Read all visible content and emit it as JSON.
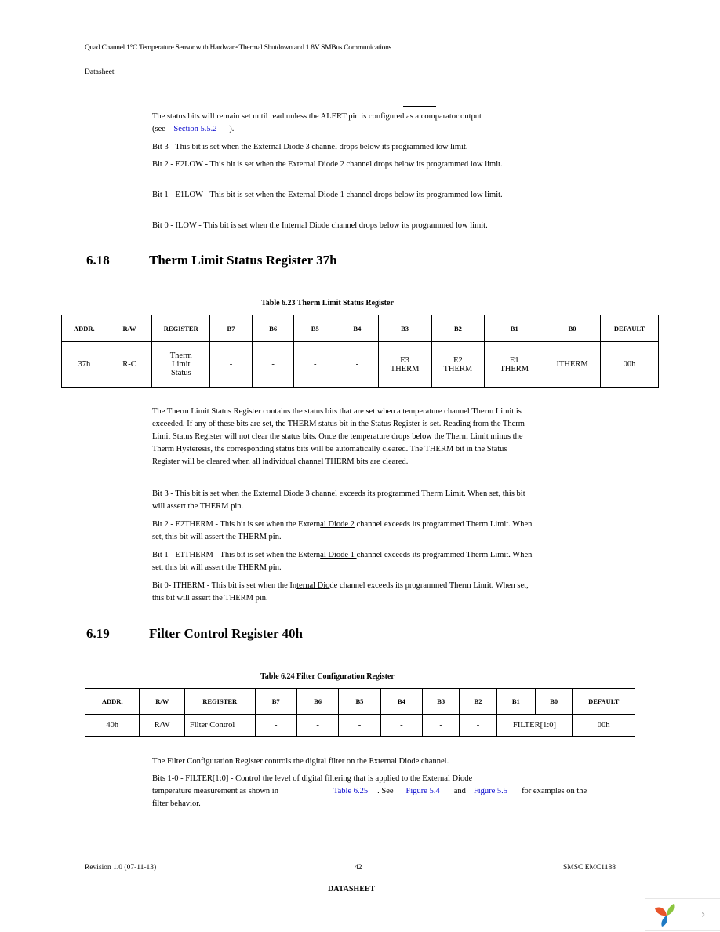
{
  "header": {
    "title": "Quad Channel 1°C Temperature Sensor with Hardware Thermal Shutdown and 1.8V SMBus Communications",
    "subtitle": "Datasheet"
  },
  "intro": {
    "status_p1": "The status bits will remain set until read unless the ALERT pin is configured as a comparator output",
    "status_p2_pre": "(see",
    "status_p2_link": "Section 5.5.2",
    "status_p2_post": ").",
    "bits": [
      "Bit 3 - This bit is set when the External Diode 3 channel drops below its programmed low limit.",
      "Bit 2 - E2LOW - This bit is set when the External Diode 2 channel drops below its programmed low limit.",
      "Bit 1 - E1LOW - This bit is set when the External Diode 1 channel drops below its programmed low limit.",
      "Bit 0 - ILOW - This bit is set when the Internal Diode channel drops below its programmed low limit."
    ]
  },
  "section_618": {
    "number": "6.18",
    "title": "Therm Limit Status Register 37h",
    "table_caption": "Table 6.23  Therm Limit Status Register",
    "table": {
      "headers": [
        "ADDR.",
        "R/W",
        "REGISTER",
        "B7",
        "B6",
        "B5",
        "B4",
        "B3",
        "B2",
        "B1",
        "B0",
        "DEFAULT"
      ],
      "row": {
        "addr": "37h",
        "rw": "R-C",
        "register_l1": "Therm",
        "register_l2": "Limit",
        "register_l3": "Status",
        "b7": "-",
        "b6": "-",
        "b5": "-",
        "b4": "-",
        "b3_l1": "E3",
        "b3_l2": "THERM",
        "b2_l1": "E2",
        "b2_l2": "THERM",
        "b1_l1": "E1",
        "b1_l2": "THERM",
        "b0": "ITHERM",
        "default": "00h"
      }
    },
    "description": "The Therm Limit Status Register contains the status bits that are set when a temperature channel Therm Limit is exceeded. If any of these bits are set, the THERM status bit in the Status Register is set. Reading from the Therm Limit Status Register will not clear the status bits. Once the temperature drops below the Therm Limit minus the Therm Hysteresis, the corresponding status bits will be automatically cleared. The THERM bit in the Status Register will be cleared when all individual channel THERM bits are cleared.",
    "bits": [
      {
        "pre": "Bit 3 - This bit is set when the Ext",
        "u": "ernal Diod",
        "post": "e 3 channel exceeds its programmed Therm Limit. When set, this bit will assert the THERM pin."
      },
      {
        "pre": "Bit 2 - E2THERM - This bit is set when the Extern",
        "u": "al Diode 2",
        "post": " channel exceeds its programmed Therm Limit. When set, this bit will assert the THERM pin."
      },
      {
        "pre": "Bit 1 - E1THERM - This bit is set when the Extern",
        "u": "al Diode 1 ",
        "post": "channel exceeds its programmed Therm Limit. When set, this bit will assert the THERM pin."
      },
      {
        "pre": "Bit 0- ITHERM - This bit is set when the In",
        "u": "ternal Dio",
        "post": "de channel exceeds its programmed Therm Limit. When set, this bit will assert the THERM pin."
      }
    ]
  },
  "section_619": {
    "number": "6.19",
    "title": "Filter Control Register 40h",
    "table_caption": "Table 6.24  Filter Configuration Register",
    "table": {
      "headers": [
        "ADDR.",
        "R/W",
        "REGISTER",
        "B7",
        "B6",
        "B5",
        "B4",
        "B3",
        "B2",
        "B1",
        "B0",
        "DEFAULT"
      ],
      "row": {
        "addr": "40h",
        "rw": "R/W",
        "register": "Filter Control",
        "b7": "-",
        "b6": "-",
        "b5": "-",
        "b4": "-",
        "b3": "-",
        "b2": "-",
        "b1_b0": "FILTER[1:0]",
        "default": "00h"
      }
    },
    "description": "The Filter Configuration Register controls the digital filter on the External Diode channel.",
    "bits_line1": "Bits 1-0 - FILTER[1:0] - Control the level of digital filtering that is applied to the External Diode",
    "bits_line2_pre": "temperature measurement as shown in",
    "link_table": "Table 6.25",
    "see": ". See",
    "link_fig1": "Figure 5.4",
    "and": "and",
    "link_fig2": "Figure 5.5",
    "bits_line2_post": "for examples on the",
    "bits_line3": "filter behavior."
  },
  "footer": {
    "revision": "Revision 1.0 (07-11-13)",
    "page_number": "42",
    "product": "SMSC EMC1188",
    "label": "DATASHEET"
  },
  "widget": {
    "logo_icon": "yii-logo-icon",
    "next_icon": "chevron-right-icon",
    "next_glyph": "›",
    "colors": {
      "orange": "#e8552b",
      "green": "#8bc53f",
      "blue": "#1f7ac4"
    }
  }
}
